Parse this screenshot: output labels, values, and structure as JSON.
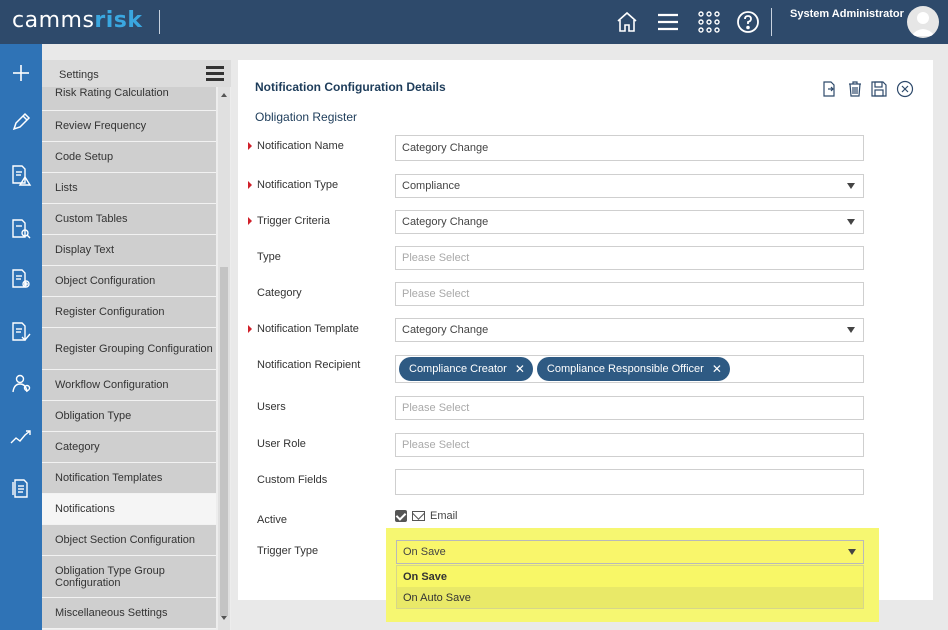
{
  "header": {
    "logo_part1": "camms",
    "logo_part2": "risk",
    "username": "System Administrator",
    "icons": [
      "home-icon",
      "menu-icon",
      "apps-grid-icon",
      "help-icon"
    ]
  },
  "rail": {
    "icons": [
      "plus-icon",
      "pencil-icon",
      "risk-document-icon",
      "search-document-icon",
      "health-document-icon",
      "checklist-document-icon",
      "people-icon",
      "trend-icon",
      "report-document-icon"
    ]
  },
  "settings": {
    "title": "Settings",
    "items": [
      "Risk Rating Calculation",
      "Review Frequency",
      "Code Setup",
      "Lists",
      "Custom Tables",
      "Display Text",
      "Object Configuration",
      "Register Configuration",
      "Register Grouping Configuration",
      "Workflow Configuration",
      "Obligation Type",
      "Category",
      "Notification Templates",
      "Notifications",
      "Object Section Configuration",
      "Obligation Type Group Configuration",
      "Miscellaneous Settings"
    ],
    "active": "Notifications"
  },
  "form": {
    "title": "Notification Configuration Details",
    "section": "Obligation Register",
    "actions": [
      "export-icon",
      "trash-icon",
      "save-icon",
      "close-icon"
    ],
    "fields": {
      "notification_name": {
        "label": "Notification Name",
        "value": "Category Change"
      },
      "notification_type": {
        "label": "Notification Type",
        "value": "Compliance"
      },
      "trigger_criteria": {
        "label": "Trigger Criteria",
        "value": "Category Change"
      },
      "type": {
        "label": "Type",
        "placeholder": "Please Select"
      },
      "category": {
        "label": "Category",
        "placeholder": "Please Select"
      },
      "notification_template": {
        "label": "Notification Template",
        "value": "Category Change"
      },
      "notification_recipient": {
        "label": "Notification Recipient",
        "tags": [
          "Compliance Creator",
          "Compliance Responsible Officer"
        ]
      },
      "users": {
        "label": "Users",
        "placeholder": "Please Select"
      },
      "user_role": {
        "label": "User Role",
        "placeholder": "Please Select"
      },
      "custom_fields": {
        "label": "Custom Fields",
        "value": ""
      },
      "active": {
        "label": "Active",
        "checkbox_label": "Email",
        "checked": true
      },
      "trigger_type": {
        "label": "Trigger Type",
        "value": "On Save",
        "options": [
          "On Save",
          "On Auto Save"
        ]
      }
    }
  },
  "colors": {
    "topbar": "#2e4a6b",
    "rail": "#2f73b6",
    "accent_blue": "#3aa7e0",
    "tag": "#2e5a83",
    "required": "#d0202a",
    "highlight": "#f6f771"
  }
}
